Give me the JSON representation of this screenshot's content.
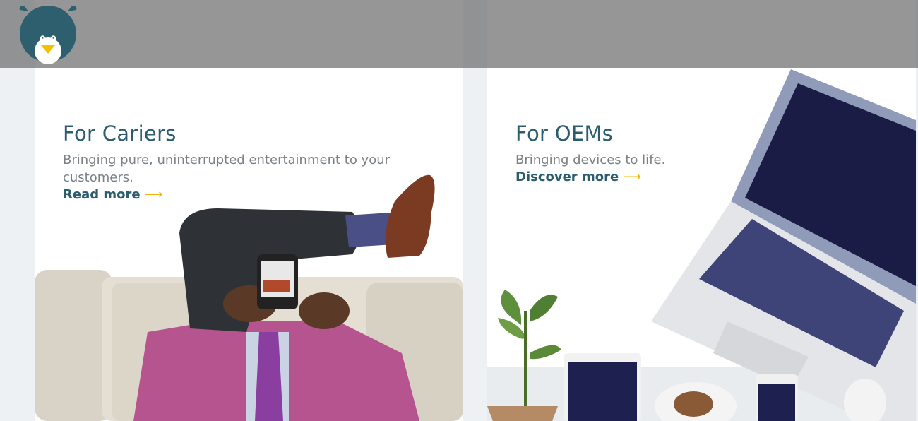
{
  "header": {
    "logo_icon": "bear-logo-icon",
    "overlay_color": "#6e6e6e"
  },
  "cards": [
    {
      "title": "For Cariers",
      "description": "Bringing pure, uninterrupted entertainment to your customers.",
      "link_label": "Read more",
      "link_arrow": "⟶",
      "image": "man-on-couch-with-phone-illustration"
    },
    {
      "title": "For OEMs",
      "description": "Bringing devices to life.",
      "link_label": "Discover more",
      "link_arrow": "⟶",
      "image": "laptop-tablet-phone-desk-illustration"
    }
  ],
  "colors": {
    "heading": "#2c5d6f",
    "body_text": "#7b8186",
    "accent_arrow": "#f0b400",
    "page_bg": "#eef1f3"
  }
}
